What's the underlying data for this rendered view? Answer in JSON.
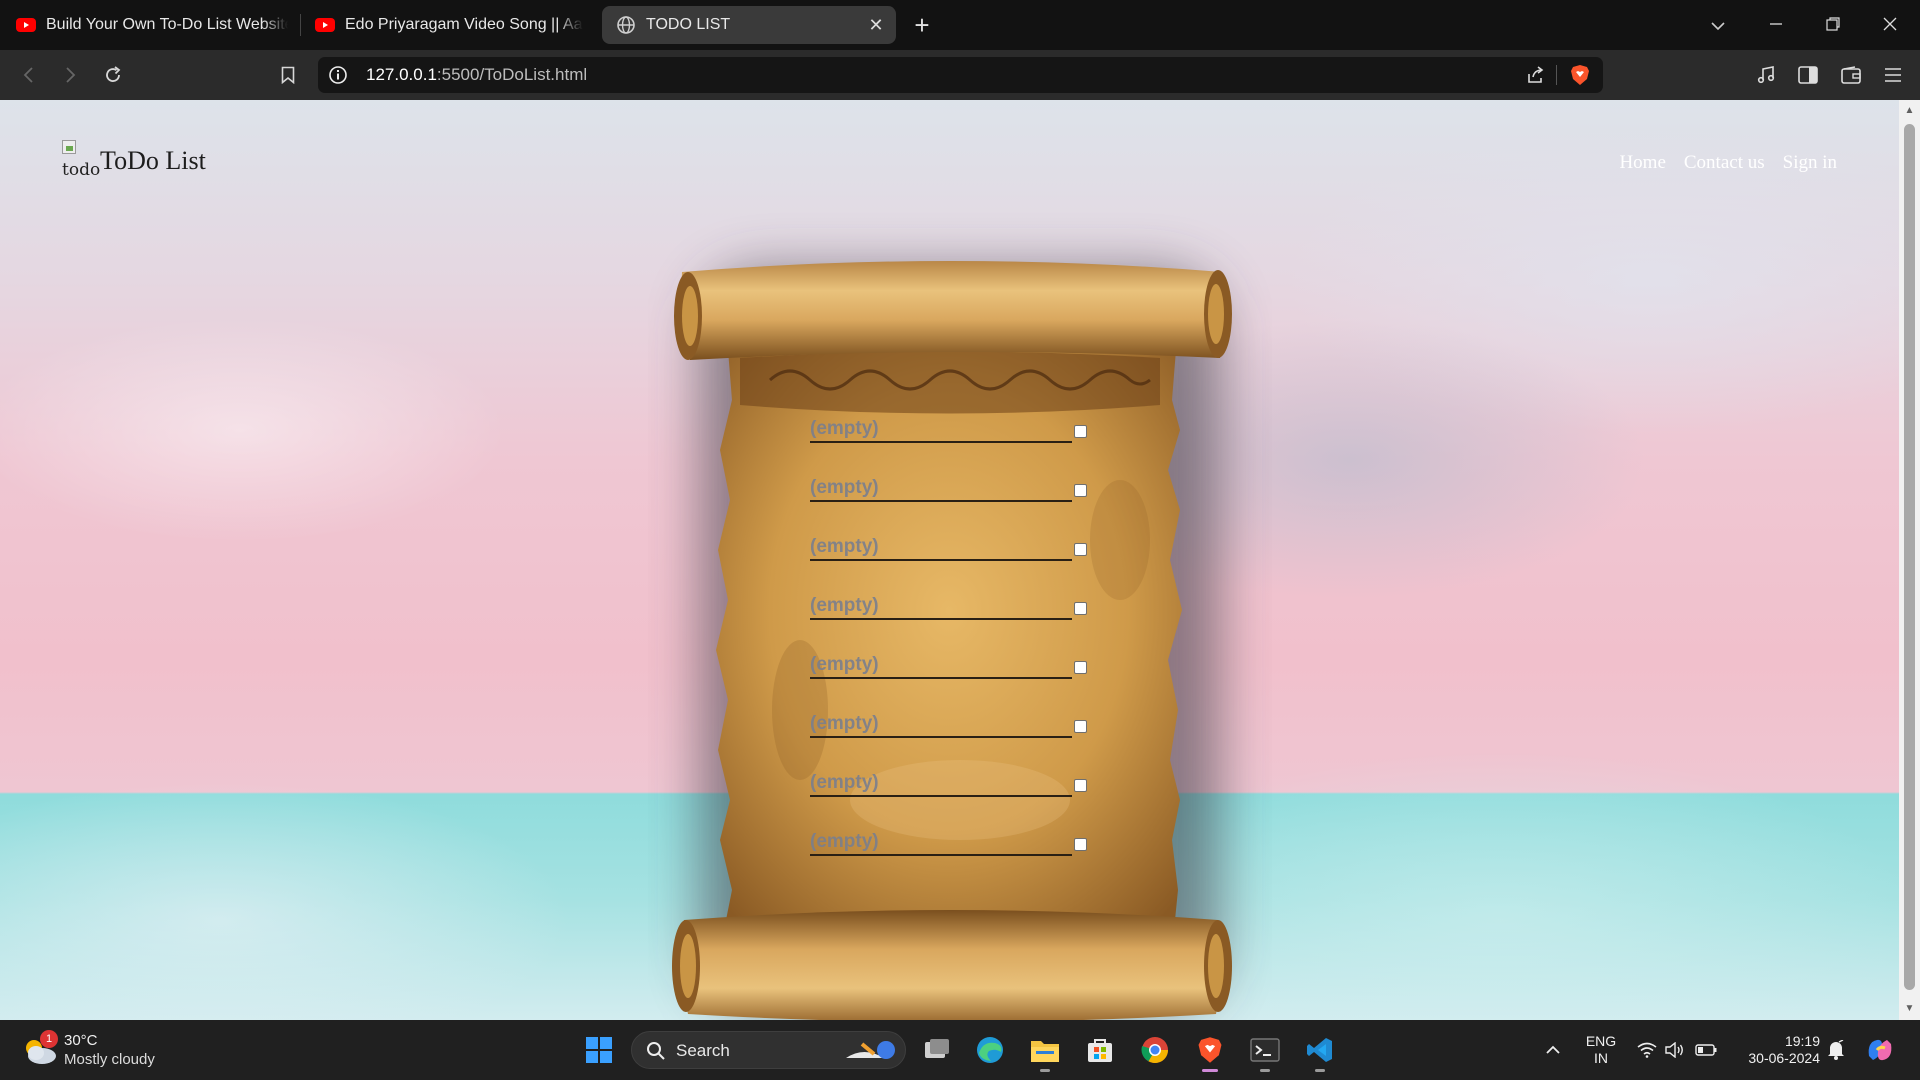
{
  "browser": {
    "tabs": [
      {
        "title": "Build Your Own To-Do List Website fr",
        "favicon": "youtube-icon"
      },
      {
        "title": "Edo Priyaragam Video Song || Aarya",
        "favicon": "youtube-icon"
      },
      {
        "title": "TODO LIST",
        "favicon": "globe-icon",
        "active": true
      }
    ],
    "url_host": "127.0.0.1",
    "url_path": ":5500/ToDoList.html"
  },
  "site": {
    "logo_alt": "todo",
    "title": "ToDo List",
    "nav": [
      "Home",
      "Contact us",
      "Sign in"
    ]
  },
  "todo": {
    "items": [
      "(empty)",
      "(empty)",
      "(empty)",
      "(empty)",
      "(empty)",
      "(empty)",
      "(empty)",
      "(empty)"
    ]
  },
  "taskbar": {
    "weather_badge": "1",
    "temperature": "30°C",
    "condition": "Mostly cloudy",
    "search_label": "Search",
    "lang_line1": "ENG",
    "lang_line2": "IN",
    "time": "19:19",
    "date": "30-06-2024"
  },
  "colors": {
    "tab_strip": "#121212",
    "toolbar": "#2b2b2b",
    "active_tab": "#3a3a3a",
    "brave_orange": "#fb542b",
    "youtube_red": "#ff0000",
    "parchment": "#c99545",
    "sea": "#8fdcdc",
    "sky_pink": "#f1c0cc"
  }
}
